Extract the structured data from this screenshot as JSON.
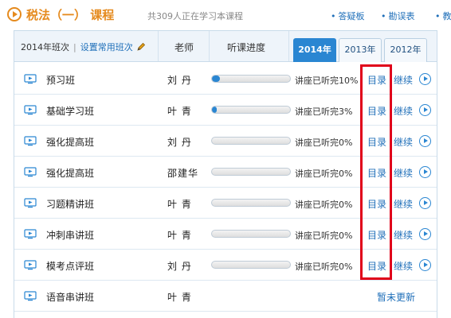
{
  "course": {
    "name": "税法（一） 课程",
    "count_text": "共309人正在学习本课程"
  },
  "top_links": [
    "答疑板",
    "勘误表",
    "教"
  ],
  "header": {
    "class_label": "2014年班次",
    "set_label": "设置常用班次",
    "teacher_col": "老师",
    "progress_col": "听课进度",
    "years": [
      "2014年",
      "2013年",
      "2012年"
    ],
    "active_year": "2014年"
  },
  "rows": [
    {
      "name": "预习班",
      "teacher": "刘 丹",
      "progress": 0.1,
      "progress_text": "讲座已听完10%",
      "menu": "目录",
      "cont": "继续"
    },
    {
      "name": "基础学习班",
      "teacher": "叶 青",
      "progress": 0.03,
      "progress_text": "讲座已听完3%",
      "menu": "目录",
      "cont": "继续"
    },
    {
      "name": "强化提高班",
      "teacher": "刘 丹",
      "progress": 0,
      "progress_text": "讲座已听完0%",
      "menu": "目录",
      "cont": "继续"
    },
    {
      "name": "强化提高班",
      "teacher": "邵建华",
      "progress": 0,
      "progress_text": "讲座已听完0%",
      "menu": "目录",
      "cont": "继续"
    },
    {
      "name": "习题精讲班",
      "teacher": "叶 青",
      "progress": 0,
      "progress_text": "讲座已听完0%",
      "menu": "目录",
      "cont": "继续"
    },
    {
      "name": "冲刺串讲班",
      "teacher": "叶 青",
      "progress": 0,
      "progress_text": "讲座已听完0%",
      "menu": "目录",
      "cont": "继续"
    },
    {
      "name": "模考点评班",
      "teacher": "刘 丹",
      "progress": 0,
      "progress_text": "讲座已听完0%",
      "menu": "目录",
      "cont": "继续"
    },
    {
      "name": "语音串讲班",
      "teacher": "叶 青",
      "not_updated": "暂未更新"
    }
  ],
  "colors": {
    "accent_orange": "#e58a1d",
    "link_blue": "#1f6fb9",
    "active_tab": "#2a86d2",
    "highlight_red": "#e0001a"
  }
}
